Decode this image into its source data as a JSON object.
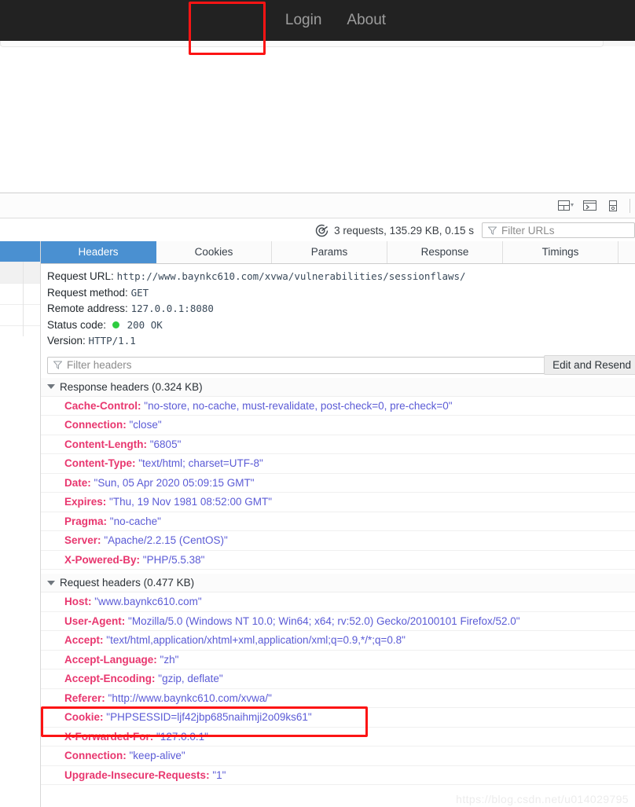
{
  "page": {
    "navbar": {
      "links": [
        {
          "label": "Login",
          "name": "nav-link-login"
        },
        {
          "label": "About",
          "name": "nav-link-about"
        }
      ]
    }
  },
  "devtools": {
    "toolbar": {
      "icons": [
        {
          "name": "split-console-layout-icon"
        },
        {
          "name": "toggle-console-icon"
        },
        {
          "name": "responsive-design-mode-icon"
        }
      ]
    },
    "network_summary": "3 requests, 135.29 KB, 0.15 s",
    "network_summary_icon": "performance-target-icon",
    "filter_urls_placeholder": "Filter URLs",
    "filter_urls_value": "",
    "filter_icon": "funnel-filter-icon",
    "tabs": [
      {
        "label": "Headers",
        "active": true
      },
      {
        "label": "Cookies",
        "active": false
      },
      {
        "label": "Params",
        "active": false
      },
      {
        "label": "Response",
        "active": false
      },
      {
        "label": "Timings",
        "active": false
      }
    ],
    "summary": {
      "request_url_label": "Request URL:",
      "request_url_value": "http://www.baynkc610.com/xvwa/vulnerabilities/sessionflaws/",
      "request_method_label": "Request method:",
      "request_method_value": "GET",
      "remote_address_label": "Remote address:",
      "remote_address_value": "127.0.0.1:8080",
      "status_code_label": "Status code:",
      "status_code_value": "200 OK",
      "status_indicator_color": "#2ecc40",
      "version_label": "Version:",
      "version_value": "HTTP/1.1"
    },
    "edit_and_resend_label": "Edit and Resend",
    "filter_headers_placeholder": "Filter headers",
    "filter_headers_value": "",
    "groups": [
      {
        "title": "Response headers (0.324 KB)",
        "rows": [
          {
            "name": "Cache-Control",
            "value": "\"no-store, no-cache, must-revalidate, post-check=0, pre-check=0\""
          },
          {
            "name": "Connection",
            "value": "\"close\""
          },
          {
            "name": "Content-Length",
            "value": "\"6805\""
          },
          {
            "name": "Content-Type",
            "value": "\"text/html; charset=UTF-8\""
          },
          {
            "name": "Date",
            "value": "\"Sun, 05 Apr 2020 05:09:15 GMT\""
          },
          {
            "name": "Expires",
            "value": "\"Thu, 19 Nov 1981 08:52:00 GMT\""
          },
          {
            "name": "Pragma",
            "value": "\"no-cache\""
          },
          {
            "name": "Server",
            "value": "\"Apache/2.2.15 (CentOS)\""
          },
          {
            "name": "X-Powered-By",
            "value": "\"PHP/5.5.38\""
          }
        ]
      },
      {
        "title": "Request headers (0.477 KB)",
        "rows": [
          {
            "name": "Host",
            "value": "\"www.baynkc610.com\""
          },
          {
            "name": "User-Agent",
            "value": "\"Mozilla/5.0 (Windows NT 10.0; Win64; x64; rv:52.0) Gecko/20100101 Firefox/52.0\""
          },
          {
            "name": "Accept",
            "value": "\"text/html,application/xhtml+xml,application/xml;q=0.9,*/*;q=0.8\""
          },
          {
            "name": "Accept-Language",
            "value": "\"zh\""
          },
          {
            "name": "Accept-Encoding",
            "value": "\"gzip, deflate\""
          },
          {
            "name": "Referer",
            "value": "\"http://www.baynkc610.com/xvwa/\""
          },
          {
            "name": "Cookie",
            "value": "\"PHPSESSID=ljf42jbp685naihmji2o09ks61\""
          },
          {
            "name": "X-Forwarded-For",
            "value": "\"127.0.0.1\""
          },
          {
            "name": "Connection",
            "value": "\"keep-alive\""
          },
          {
            "name": "Upgrade-Insecure-Requests",
            "value": "\"1\""
          }
        ]
      }
    ]
  },
  "annotations": {
    "color": "#fc1414",
    "boxes": [
      {
        "target": "nav-link-login"
      },
      {
        "target": "request-header-cookie"
      }
    ]
  },
  "watermark": "https://blog.csdn.net/u014029795"
}
